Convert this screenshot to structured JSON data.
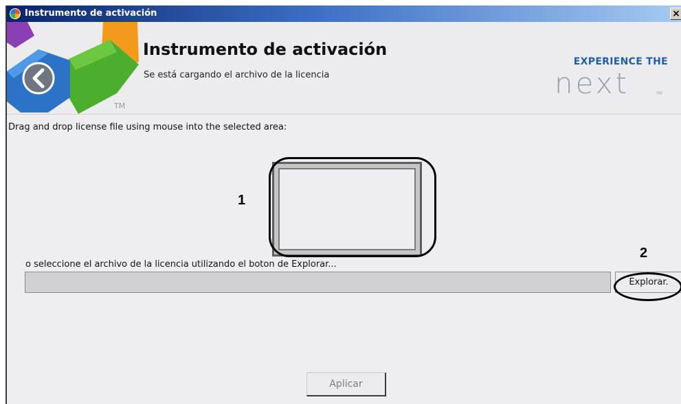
{
  "window": {
    "title": "Instrumento de activación",
    "close_label": "×"
  },
  "header": {
    "title": "Instrumento de activación",
    "subtitle": "Se está cargando el archivo de la licencia",
    "logo_tm": "TM",
    "brand_line1": "EXPERIENCE THE",
    "brand_line2": "next",
    "brand_tm": "TM",
    "brand_color": "#1f5fa3"
  },
  "main": {
    "instructions": "Drag and drop license file using mouse into the selected area:",
    "drop_area_callout": "1",
    "select_label": "o seleccione el archivo de la licencia utilizando el boton de Explorar...",
    "file_path_value": "",
    "browse_label": "Explorar.",
    "browse_callout": "2",
    "apply_label": "Aplicar"
  },
  "icons": {
    "app": "app-logo-icon",
    "back": "back-arrow-icon",
    "close": "close-icon"
  }
}
